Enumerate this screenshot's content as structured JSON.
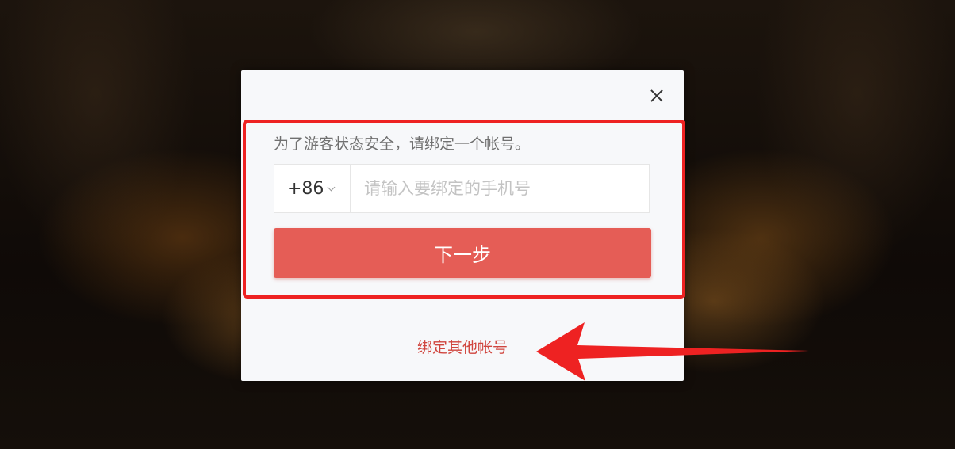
{
  "dialog": {
    "hint": "为了游客状态安全，请绑定一个帐号。",
    "country_code": "+86",
    "phone_placeholder": "请输入要绑定的手机号",
    "phone_value": "",
    "next_label": "下一步",
    "other_account_link": "绑定其他帐号"
  },
  "colors": {
    "accent": "#e55d56",
    "link": "#d0453e",
    "annotation": "#ee2222"
  },
  "icons": {
    "close": "close-icon",
    "dropdown": "chevron-down-icon",
    "annotation_arrow": "arrow-left-icon"
  }
}
